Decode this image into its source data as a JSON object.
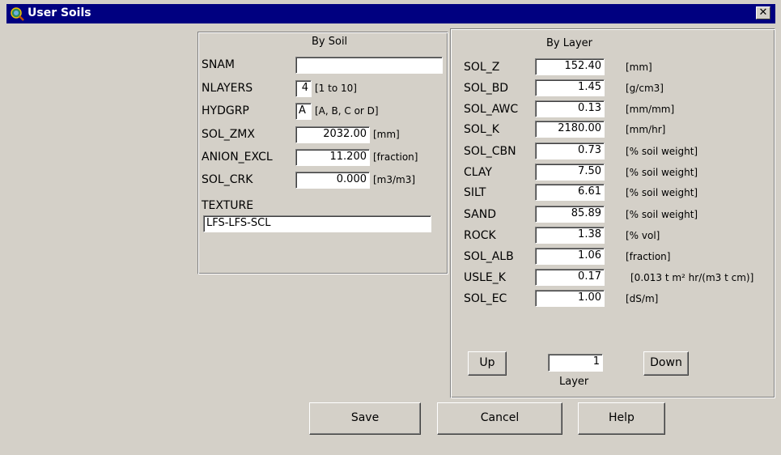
{
  "window": {
    "title": "User Soils",
    "close_label": "✕"
  },
  "by_soil": {
    "header": "By Soil",
    "snam": {
      "label": "SNAM",
      "value": ""
    },
    "nlayers": {
      "label": "NLAYERS",
      "value": "4",
      "unit": "[1 to 10]"
    },
    "hydgrp": {
      "label": "HYDGRP",
      "value": "A",
      "unit": "[A, B, C or D]"
    },
    "sol_zmx": {
      "label": "SOL_ZMX",
      "value": "2032.00",
      "unit": "[mm]"
    },
    "anion_excl": {
      "label": "ANION_EXCL",
      "value": "11.200",
      "unit": "[fraction]"
    },
    "sol_crk": {
      "label": "SOL_CRK",
      "value": "0.000",
      "unit": "[m3/m3]"
    },
    "texture": {
      "label": "TEXTURE",
      "value": "LFS-LFS-SCL"
    }
  },
  "by_layer": {
    "header": "By Layer",
    "rows": [
      {
        "label": "SOL_Z",
        "value": "152.40",
        "unit": "[mm]"
      },
      {
        "label": "SOL_BD",
        "value": "1.45",
        "unit": "[g/cm3]"
      },
      {
        "label": "SOL_AWC",
        "value": "0.13",
        "unit": "[mm/mm]"
      },
      {
        "label": "SOL_K",
        "value": "2180.00",
        "unit": "[mm/hr]"
      },
      {
        "label": "SOL_CBN",
        "value": "0.73",
        "unit": "[% soil weight]"
      },
      {
        "label": "CLAY",
        "value": "7.50",
        "unit": "[% soil weight]"
      },
      {
        "label": "SILT",
        "value": "6.61",
        "unit": "[% soil weight]"
      },
      {
        "label": "SAND",
        "value": "85.89",
        "unit": "[% soil weight]"
      },
      {
        "label": "ROCK",
        "value": "1.38",
        "unit": "[% vol]"
      },
      {
        "label": "SOL_ALB",
        "value": "1.06",
        "unit": "[fraction]"
      },
      {
        "label": "USLE_K",
        "value": "0.17",
        "unit": "[0.013 t m² hr/(m3 t cm)]"
      },
      {
        "label": "SOL_EC",
        "value": "1.00",
        "unit": "[dS/m]"
      }
    ],
    "up_label": "Up",
    "down_label": "Down",
    "layer_value": "1",
    "layer_label": "Layer"
  },
  "buttons": {
    "save": "Save",
    "cancel": "Cancel",
    "help": "Help"
  }
}
